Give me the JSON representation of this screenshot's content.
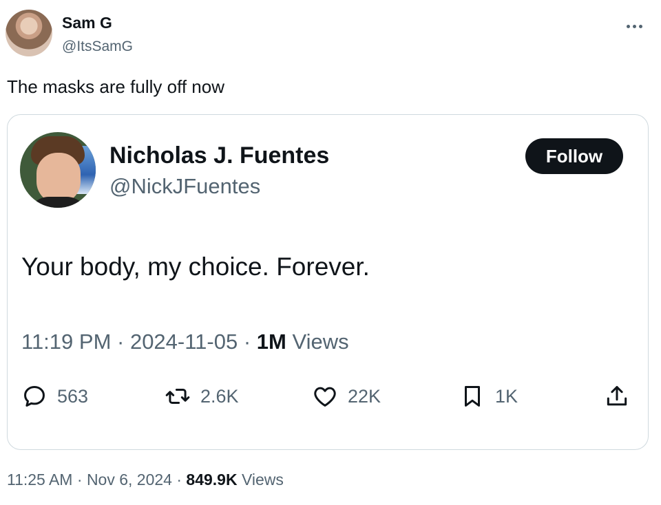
{
  "outer_tweet": {
    "author_name": "Sam G",
    "author_handle": "@ItsSamG",
    "text": "The masks are fully off now",
    "time": "11:25 AM",
    "date": "Nov 6, 2024",
    "views_count": "849.9K",
    "views_label": "Views",
    "more_icon": "more-horizontal-icon"
  },
  "quoted_tweet": {
    "author_name": "Nicholas J. Fuentes",
    "author_handle": "@NickJFuentes",
    "follow_label": "Follow",
    "text": "Your body, my choice. Forever.",
    "time": "11:19 PM",
    "date": "2024-11-05",
    "views_count": "1M",
    "views_label": "Views",
    "actions": {
      "reply": {
        "icon": "reply-icon",
        "count": "563"
      },
      "retweet": {
        "icon": "retweet-icon",
        "count": "2.6K"
      },
      "like": {
        "icon": "heart-icon",
        "count": "22K"
      },
      "bookmark": {
        "icon": "bookmark-icon",
        "count": "1K"
      },
      "share": {
        "icon": "share-icon"
      }
    }
  },
  "colors": {
    "text_primary": "#0f1419",
    "text_secondary": "#536471",
    "border": "#cfd9de",
    "button_bg": "#0f1419"
  }
}
